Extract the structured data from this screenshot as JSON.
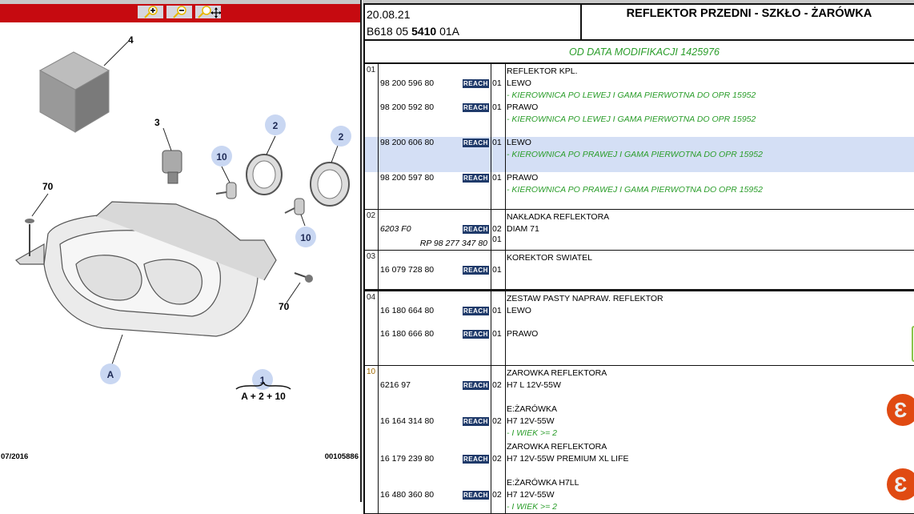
{
  "toolbar": {
    "zoom_in": "zoom-in",
    "zoom_out": "zoom-out",
    "zoom_pan": "zoom-pan"
  },
  "diagram": {
    "callouts": {
      "c4": "4",
      "c3": "3",
      "c2a": "2",
      "c2b": "2",
      "c10a": "10",
      "c10b": "10",
      "c70a": "70",
      "c70b": "70",
      "cA": "A",
      "c1": "1"
    },
    "formula": "A + 2 + 10",
    "date": "07/2016",
    "number": "00105886"
  },
  "header": {
    "date": "20.08.21",
    "code_prefix": "B618 05 ",
    "code_bold": "5410",
    "code_suffix": " 01A",
    "title": "REFLEKTOR PRZEDNI - SZKŁO - ŻARÓWKA"
  },
  "modification": "OD DATA MODIFIKACJI 1425976",
  "reach_label": "REACH",
  "groups": [
    {
      "index": "01",
      "entries": [
        {
          "title": "REFLEKTOR KPL.",
          "ref": "98 200 596 80",
          "qty": "01",
          "desc": "LEWO",
          "note": "- KIEROWNICA PO LEWEJ I GAMA PIERWOTNA DO OPR 15952"
        },
        {
          "ref": "98 200 592 80",
          "qty": "01",
          "desc": "PRAWO",
          "note": "- KIEROWNICA PO LEWEJ I GAMA PIERWOTNA DO OPR 15952"
        },
        {
          "ref": "98 200 606 80",
          "qty": "01",
          "desc": "LEWO",
          "note": "- KIEROWNICA PO PRAWEJ I GAMA PIERWOTNA DO OPR 15952",
          "highlighted": true
        },
        {
          "ref": "98 200 597 80",
          "qty": "01",
          "desc": "PRAWO",
          "note": "- KIEROWNICA PO PRAWEJ I GAMA PIERWOTNA DO OPR 15952"
        }
      ]
    },
    {
      "index": "02",
      "entries": [
        {
          "title": "NAKŁADKA REFLEKTORA",
          "ref": "6203 F0",
          "italic": true,
          "qty": "02",
          "desc": "DIAM 71",
          "sub_ref": "RP 98 277 347 80",
          "sub_qty": "01"
        }
      ]
    },
    {
      "index": "03",
      "entries": [
        {
          "title": "KOREKTOR SWIATEL",
          "ref": "16 079 728 80",
          "qty": "01",
          "desc": ""
        }
      ]
    },
    {
      "index": "04",
      "entries": [
        {
          "title": "ZESTAW PASTY NAPRAW. REFLEKTOR",
          "ref": "16 180 664 80",
          "qty": "01",
          "desc": "LEWO"
        },
        {
          "ref": "16 180 666 80",
          "qty": "01",
          "desc": "PRAWO"
        }
      ]
    },
    {
      "index": "10",
      "entries": [
        {
          "title": "ZAROWKA REFLEKTORA",
          "ref": "6216 97",
          "qty": "02",
          "desc": "H7 L 12V-55W"
        },
        {
          "title": "E:ŻARÓWKA",
          "ref": "16 164 314 80",
          "qty": "02",
          "desc": "H7 12V-55W",
          "note": "- I WIEK >= 2"
        },
        {
          "title": "ZAROWKA REFLEKTORA",
          "ref": "16 179 239 80",
          "qty": "02",
          "desc": "H7 12V-55W PREMIUM XL LIFE"
        },
        {
          "title": "E:ŻARÓWKA H7LL",
          "ref": "16 480 360 80",
          "qty": "02",
          "desc": "H7 12V-55W",
          "note": "- I WIEK >= 2"
        }
      ]
    }
  ],
  "colors": {
    "toolbar": "#c60a10",
    "reach": "#1f3a6a",
    "note": "#2a9d2a",
    "highlight": "#d4dff5",
    "eshop": "#e04a12"
  }
}
